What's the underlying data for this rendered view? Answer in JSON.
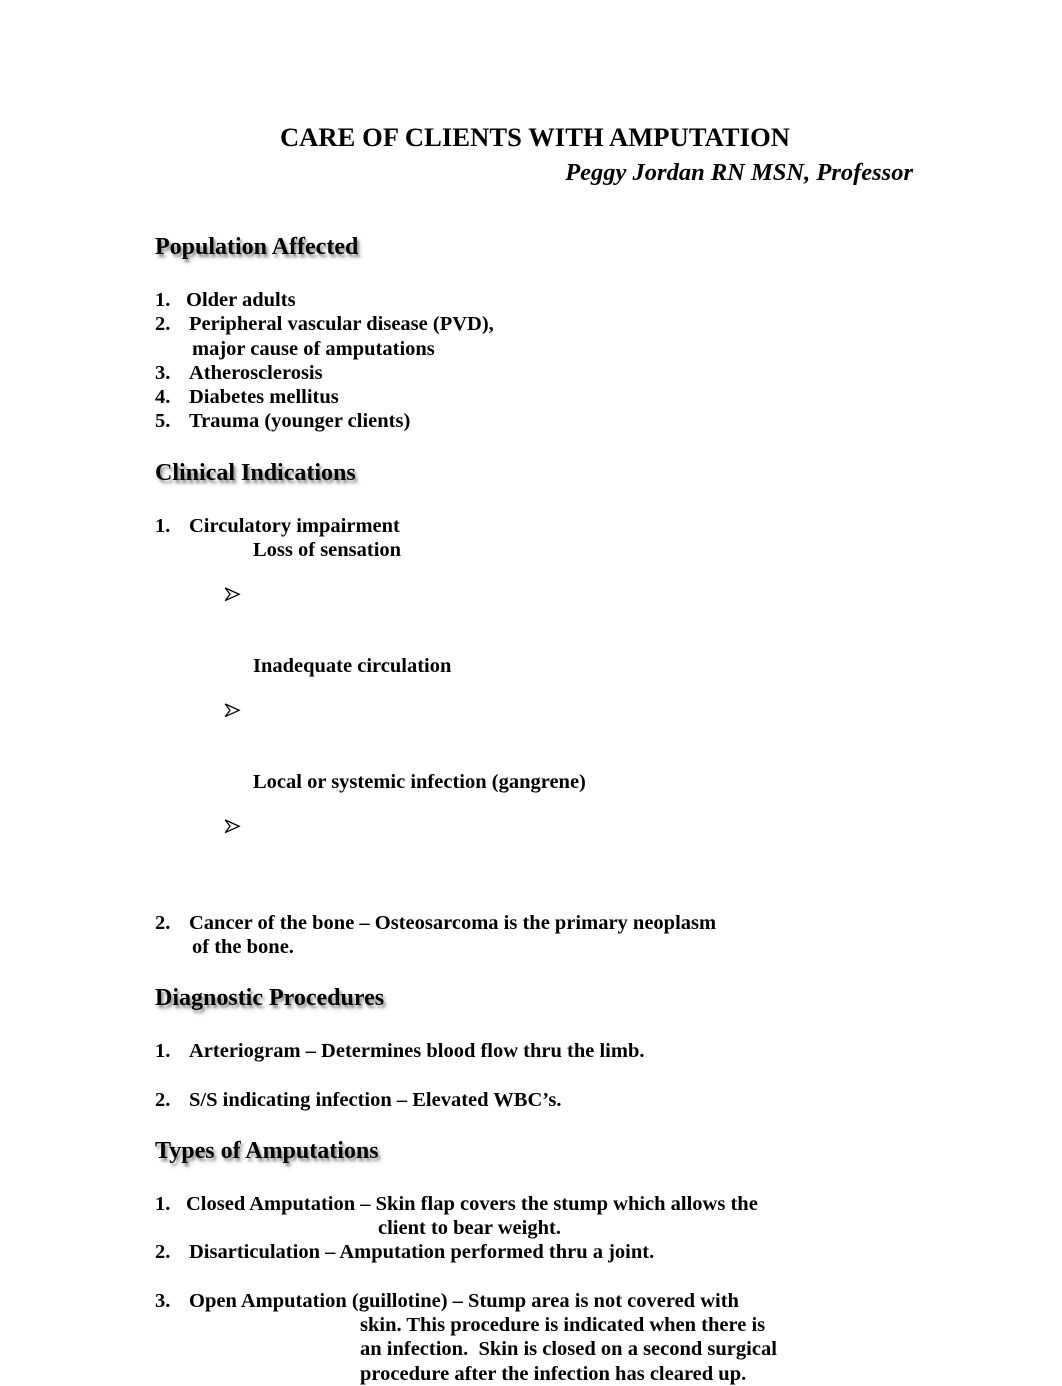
{
  "document": {
    "title": "CARE OF CLIENTS WITH AMPUTATION",
    "byline": "Peggy Jordan RN MSN, Professor",
    "background_color": "#ffffff",
    "text_color": "#000000",
    "heading_shadow_color": "#8a8a8a"
  },
  "sections": {
    "population": {
      "heading": "Population Affected",
      "items": [
        {
          "num": "1.",
          "text": "Older adults"
        },
        {
          "num": "2.",
          "text": "Peripheral vascular disease (PVD),"
        },
        {
          "num": "",
          "text": "major cause of amputations"
        },
        {
          "num": "3.",
          "text": "Atherosclerosis"
        },
        {
          "num": "4.",
          "text": "Diabetes mellitus"
        },
        {
          "num": "5.",
          "text": "Trauma (younger clients)"
        }
      ]
    },
    "clinical": {
      "heading": "Clinical Indications",
      "item1_num": "1.",
      "item1_text": "Circulatory impairment",
      "bullets": [
        "Loss of sensation",
        "Inadequate circulation",
        "Local or systemic infection (gangrene)"
      ],
      "item2_num": "2.",
      "item2_line1": "Cancer of the bone – Osteosarcoma is the primary neoplasm",
      "item2_line2": "of the bone."
    },
    "diagnostic": {
      "heading": "Diagnostic Procedures",
      "items": [
        {
          "num": "1.",
          "text": "Arteriogram – Determines blood flow thru the limb."
        },
        {
          "num": "2.",
          "text": "S/S indicating infection – Elevated WBC’s."
        }
      ]
    },
    "types": {
      "heading": "Types of Amputations",
      "item1_num": "1.",
      "item1_line1": "Closed Amputation – Skin flap covers the stump which allows the",
      "item1_line2": "client to bear weight.",
      "item2_num": "2.",
      "item2_text": "Disarticulation – Amputation performed thru a joint.",
      "item3_num": "3.",
      "item3_line1": "Open Amputation (guillotine) – Stump area is not covered with",
      "item3_line2": "skin. This procedure is indicated when there is",
      "item3_line3": "an infection.  Skin is closed on a second surgical",
      "item3_line4": "procedure after the infection has cleared up."
    }
  }
}
